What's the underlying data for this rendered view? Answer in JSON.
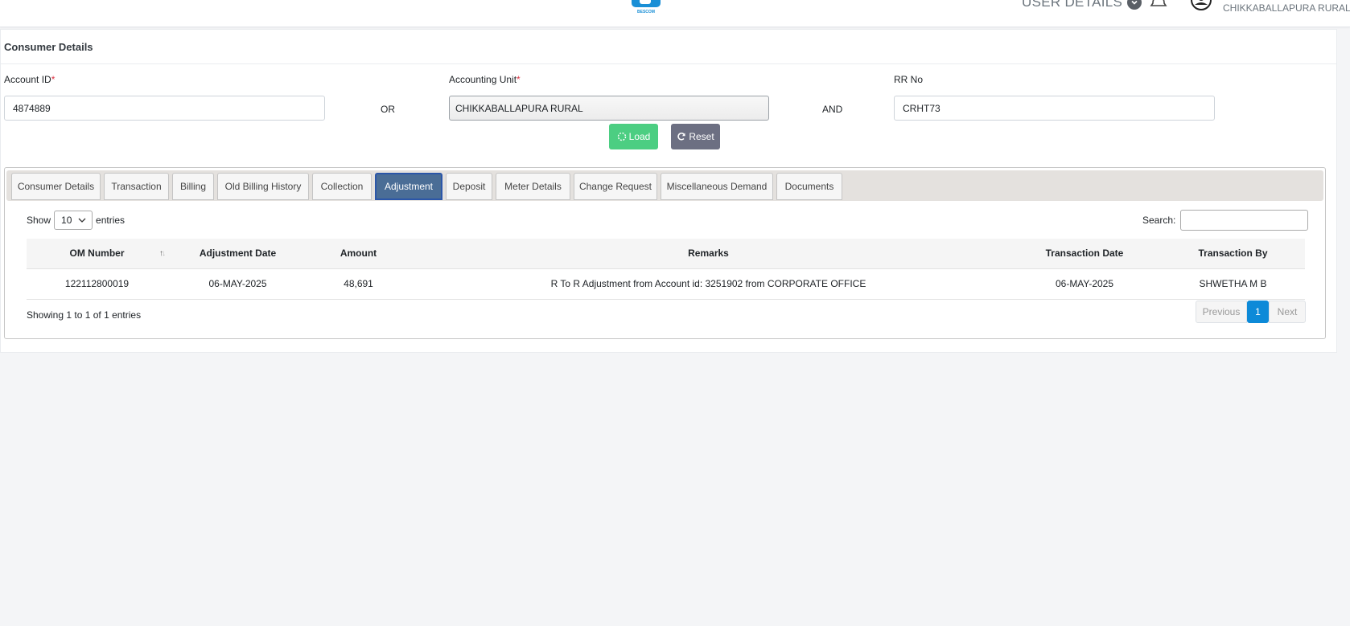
{
  "header": {
    "logo_text": "BESCOM",
    "user_details_label": "USER DETAILS",
    "unit_name": "CHIKKABALLAPURA RURAL"
  },
  "card": {
    "title": "Consumer Details"
  },
  "form": {
    "account_id_label": "Account ID",
    "account_id_value": "4874889",
    "or_label": "OR",
    "accounting_unit_label": "Accounting Unit",
    "accounting_unit_value": "CHIKKABALLAPURA RURAL",
    "and_label": "AND",
    "rr_no_label": "RR No",
    "rr_no_value": "CRHT73",
    "required_mark": "*",
    "load_label": "Load",
    "reset_label": "Reset"
  },
  "tabs": [
    {
      "label": "Consumer Details"
    },
    {
      "label": "Transaction"
    },
    {
      "label": "Billing"
    },
    {
      "label": "Old Billing History"
    },
    {
      "label": "Collection"
    },
    {
      "label": "Adjustment",
      "active": true
    },
    {
      "label": "Deposit"
    },
    {
      "label": "Meter Details"
    },
    {
      "label": "Change Request"
    },
    {
      "label": "Miscellaneous Demand"
    },
    {
      "label": "Documents"
    }
  ],
  "table_controls": {
    "show_label": "Show",
    "page_length": "10",
    "entries_label": "entries",
    "search_label": "Search:",
    "search_value": ""
  },
  "table": {
    "columns": [
      "OM Number",
      "Adjustment Date",
      "Amount",
      "Remarks",
      "Transaction Date",
      "Transaction By"
    ],
    "rows": [
      [
        "122112800019",
        "06-MAY-2025",
        "48,691",
        "R To R Adjustment from Account id: 3251902 from CORPORATE OFFICE",
        "06-MAY-2025",
        "SHWETHA M B"
      ]
    ]
  },
  "footer": {
    "info": "Showing 1 to 1 of 1 entries",
    "previous_label": "Previous",
    "current_page": "1",
    "next_label": "Next"
  },
  "colors": {
    "load": "#4cce82",
    "reset": "#6c6f82",
    "active_tab": "#4a6d96",
    "page_current": "#0d8ad8",
    "logo": "#1a8fd6",
    "required": "#dc3545"
  }
}
